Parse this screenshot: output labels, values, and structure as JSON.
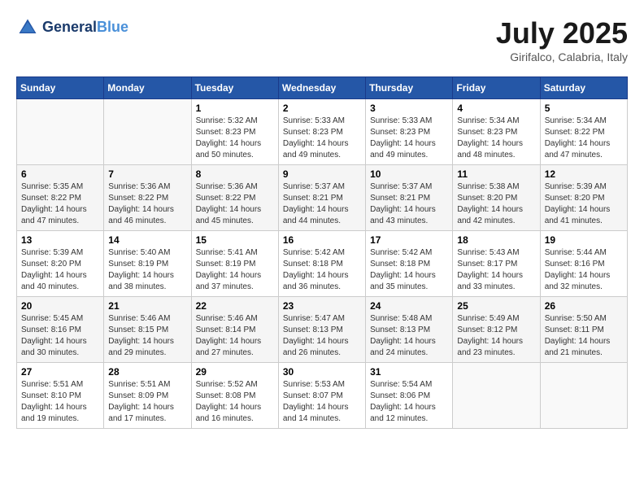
{
  "header": {
    "logo_line1": "General",
    "logo_line2": "Blue",
    "month": "July 2025",
    "location": "Girifalco, Calabria, Italy"
  },
  "weekdays": [
    "Sunday",
    "Monday",
    "Tuesday",
    "Wednesday",
    "Thursday",
    "Friday",
    "Saturday"
  ],
  "weeks": [
    [
      {
        "day": "",
        "info": ""
      },
      {
        "day": "",
        "info": ""
      },
      {
        "day": "1",
        "info": "Sunrise: 5:32 AM\nSunset: 8:23 PM\nDaylight: 14 hours and 50 minutes."
      },
      {
        "day": "2",
        "info": "Sunrise: 5:33 AM\nSunset: 8:23 PM\nDaylight: 14 hours and 49 minutes."
      },
      {
        "day": "3",
        "info": "Sunrise: 5:33 AM\nSunset: 8:23 PM\nDaylight: 14 hours and 49 minutes."
      },
      {
        "day": "4",
        "info": "Sunrise: 5:34 AM\nSunset: 8:23 PM\nDaylight: 14 hours and 48 minutes."
      },
      {
        "day": "5",
        "info": "Sunrise: 5:34 AM\nSunset: 8:22 PM\nDaylight: 14 hours and 47 minutes."
      }
    ],
    [
      {
        "day": "6",
        "info": "Sunrise: 5:35 AM\nSunset: 8:22 PM\nDaylight: 14 hours and 47 minutes."
      },
      {
        "day": "7",
        "info": "Sunrise: 5:36 AM\nSunset: 8:22 PM\nDaylight: 14 hours and 46 minutes."
      },
      {
        "day": "8",
        "info": "Sunrise: 5:36 AM\nSunset: 8:22 PM\nDaylight: 14 hours and 45 minutes."
      },
      {
        "day": "9",
        "info": "Sunrise: 5:37 AM\nSunset: 8:21 PM\nDaylight: 14 hours and 44 minutes."
      },
      {
        "day": "10",
        "info": "Sunrise: 5:37 AM\nSunset: 8:21 PM\nDaylight: 14 hours and 43 minutes."
      },
      {
        "day": "11",
        "info": "Sunrise: 5:38 AM\nSunset: 8:20 PM\nDaylight: 14 hours and 42 minutes."
      },
      {
        "day": "12",
        "info": "Sunrise: 5:39 AM\nSunset: 8:20 PM\nDaylight: 14 hours and 41 minutes."
      }
    ],
    [
      {
        "day": "13",
        "info": "Sunrise: 5:39 AM\nSunset: 8:20 PM\nDaylight: 14 hours and 40 minutes."
      },
      {
        "day": "14",
        "info": "Sunrise: 5:40 AM\nSunset: 8:19 PM\nDaylight: 14 hours and 38 minutes."
      },
      {
        "day": "15",
        "info": "Sunrise: 5:41 AM\nSunset: 8:19 PM\nDaylight: 14 hours and 37 minutes."
      },
      {
        "day": "16",
        "info": "Sunrise: 5:42 AM\nSunset: 8:18 PM\nDaylight: 14 hours and 36 minutes."
      },
      {
        "day": "17",
        "info": "Sunrise: 5:42 AM\nSunset: 8:18 PM\nDaylight: 14 hours and 35 minutes."
      },
      {
        "day": "18",
        "info": "Sunrise: 5:43 AM\nSunset: 8:17 PM\nDaylight: 14 hours and 33 minutes."
      },
      {
        "day": "19",
        "info": "Sunrise: 5:44 AM\nSunset: 8:16 PM\nDaylight: 14 hours and 32 minutes."
      }
    ],
    [
      {
        "day": "20",
        "info": "Sunrise: 5:45 AM\nSunset: 8:16 PM\nDaylight: 14 hours and 30 minutes."
      },
      {
        "day": "21",
        "info": "Sunrise: 5:46 AM\nSunset: 8:15 PM\nDaylight: 14 hours and 29 minutes."
      },
      {
        "day": "22",
        "info": "Sunrise: 5:46 AM\nSunset: 8:14 PM\nDaylight: 14 hours and 27 minutes."
      },
      {
        "day": "23",
        "info": "Sunrise: 5:47 AM\nSunset: 8:13 PM\nDaylight: 14 hours and 26 minutes."
      },
      {
        "day": "24",
        "info": "Sunrise: 5:48 AM\nSunset: 8:13 PM\nDaylight: 14 hours and 24 minutes."
      },
      {
        "day": "25",
        "info": "Sunrise: 5:49 AM\nSunset: 8:12 PM\nDaylight: 14 hours and 23 minutes."
      },
      {
        "day": "26",
        "info": "Sunrise: 5:50 AM\nSunset: 8:11 PM\nDaylight: 14 hours and 21 minutes."
      }
    ],
    [
      {
        "day": "27",
        "info": "Sunrise: 5:51 AM\nSunset: 8:10 PM\nDaylight: 14 hours and 19 minutes."
      },
      {
        "day": "28",
        "info": "Sunrise: 5:51 AM\nSunset: 8:09 PM\nDaylight: 14 hours and 17 minutes."
      },
      {
        "day": "29",
        "info": "Sunrise: 5:52 AM\nSunset: 8:08 PM\nDaylight: 14 hours and 16 minutes."
      },
      {
        "day": "30",
        "info": "Sunrise: 5:53 AM\nSunset: 8:07 PM\nDaylight: 14 hours and 14 minutes."
      },
      {
        "day": "31",
        "info": "Sunrise: 5:54 AM\nSunset: 8:06 PM\nDaylight: 14 hours and 12 minutes."
      },
      {
        "day": "",
        "info": ""
      },
      {
        "day": "",
        "info": ""
      }
    ]
  ]
}
